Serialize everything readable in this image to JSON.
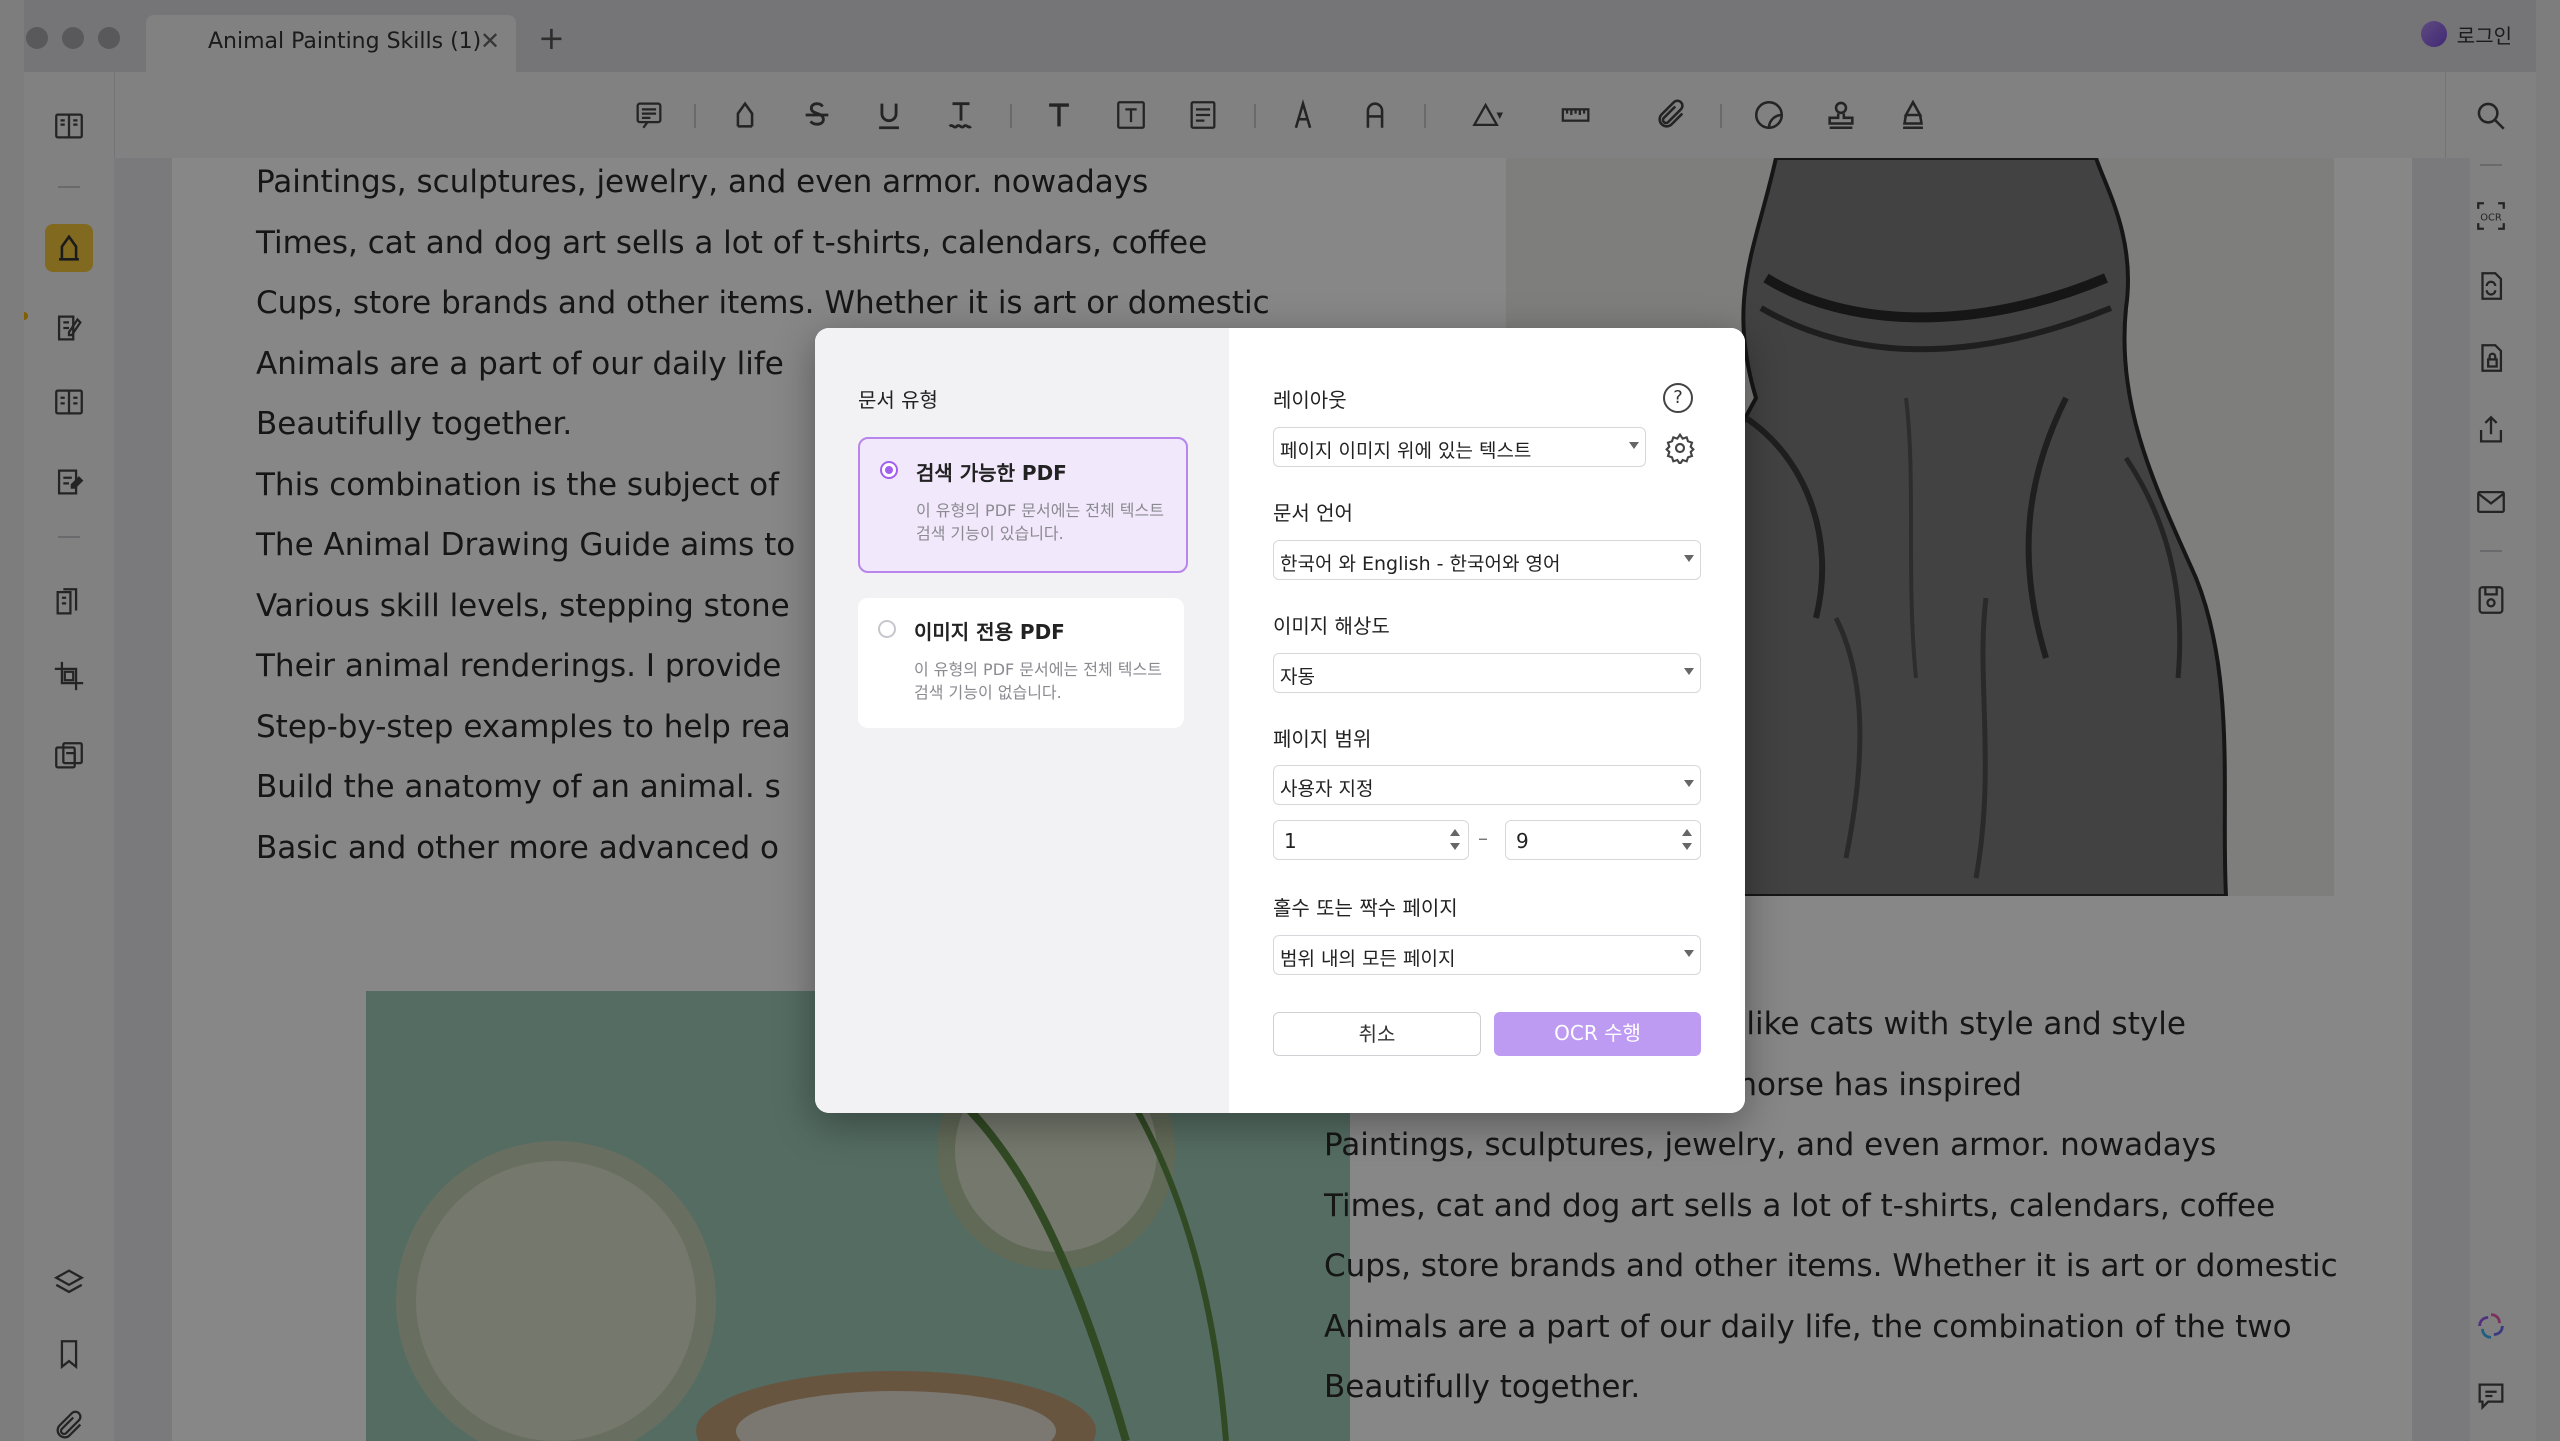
{
  "window": {
    "tab_title": "Animal Painting Skills (1)",
    "tab_close": "✕",
    "tab_add": "+",
    "login_label": "로그인"
  },
  "document": {
    "top_left_lines": [
      "Paintings, sculptures, jewelry, and even armor. nowadays",
      "Times, cat and dog art sells a lot of t-shirts, calendars, coffee",
      "Cups, store brands and other items. Whether it is art or domestic",
      "Animals are a part of our daily life",
      "Beautifully together.",
      "This combination is the subject of",
      "The Animal Drawing Guide aims to",
      "Various skill levels, stepping stone",
      "Their animal renderings. I provide",
      "Step-by-step examples to help rea",
      "Build the anatomy of an animal. s",
      "Basic and other more advanced o"
    ],
    "bottom_right_lines": [
      "Cats and dogs are animals like cats with style and style",
      "Beauty. For centuries, this horse has inspired",
      "Paintings, sculptures, jewelry, and even armor. nowadays",
      "Times, cat and dog art sells a lot of t-shirts, calendars, coffee",
      "Cups, store brands and other items. Whether it is art or domestic",
      "Animals are a part of our daily life, the combination of the two",
      "Beautifully together."
    ]
  },
  "dialog": {
    "doc_type_label": "문서 유형",
    "options": [
      {
        "title": "검색 가능한 PDF",
        "desc": "이 유형의 PDF 문서에는 전체 텍스트 검색 기능이 있습니다.",
        "selected": true
      },
      {
        "title": "이미지 전용 PDF",
        "desc": "이 유형의 PDF 문서에는 전체 텍스트 검색 기능이 없습니다.",
        "selected": false
      }
    ],
    "layout_label": "레이아웃",
    "layout_value": "페이지 이미지 위에 있는 텍스트",
    "language_label": "문서 언어",
    "language_value": "한국어 와 English - 한국어와 영어",
    "resolution_label": "이미지 해상도",
    "resolution_value": "자동",
    "range_label": "페이지 범위",
    "range_value": "사용자 지정",
    "range_from": "1",
    "range_dash": "–",
    "range_to": "9",
    "oddeven_label": "홀수 또는 짝수 페이지",
    "oddeven_value": "범위 내의 모든 페이지",
    "help_icon": "?",
    "cancel_label": "취소",
    "ok_label": "OCR 수행"
  },
  "colors": {
    "accent": "#be9bf3",
    "active_tool": "#f3c93b",
    "radio_selected": "#a260f0"
  },
  "icons": {
    "toolbar": [
      "comment-icon",
      "highlighter-icon",
      "strikethrough-icon",
      "underline-icon",
      "squiggly-underline-icon",
      "text-icon",
      "textbox-icon",
      "text-callout-icon",
      "pencil-icon",
      "eraser-icon",
      "shape-icon",
      "measure-icon",
      "attachment-icon",
      "sticker-icon",
      "stamp-icon",
      "signature-icon"
    ],
    "left": [
      "reader-icon",
      "comment-mode-icon",
      "edit-icon",
      "organize-icon",
      "form-icon",
      "ocr-pages-icon",
      "crop-icon",
      "compare-icon",
      "layers-icon",
      "bookmark-icon",
      "attachment-icon"
    ],
    "right": [
      "search-icon",
      "ocr-icon",
      "convert-icon",
      "protect-icon",
      "share-icon",
      "email-icon",
      "save-icon",
      "ai-icon",
      "chat-icon"
    ]
  }
}
